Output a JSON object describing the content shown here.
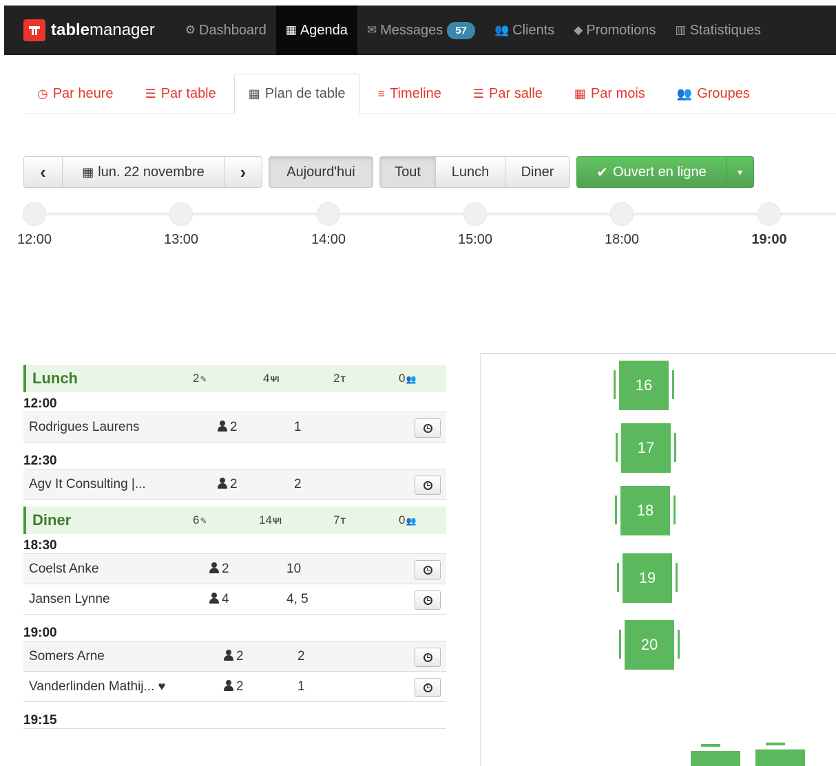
{
  "nav": {
    "brand_bold": "table",
    "brand_rest": "manager",
    "items": [
      {
        "icon": "dashboard-icon",
        "label": "Dashboard"
      },
      {
        "icon": "calendar-icon",
        "label": "Agenda"
      },
      {
        "icon": "envelope-icon",
        "label": "Messages",
        "badge": "57"
      },
      {
        "icon": "users-icon",
        "label": "Clients"
      },
      {
        "icon": "tag-icon",
        "label": "Promotions"
      },
      {
        "icon": "bar-chart-icon",
        "label": "Statistiques"
      }
    ]
  },
  "tabs": [
    {
      "icon": "clock-icon",
      "label": "Par heure"
    },
    {
      "icon": "list-icon",
      "label": "Par table"
    },
    {
      "icon": "grid-icon",
      "label": "Plan de table"
    },
    {
      "icon": "bars-icon",
      "label": "Timeline"
    },
    {
      "icon": "list-icon",
      "label": "Par salle"
    },
    {
      "icon": "calendar-icon",
      "label": "Par mois"
    },
    {
      "icon": "group-icon",
      "label": "Groupes"
    }
  ],
  "controls": {
    "prev": "‹",
    "date": "lun. 22 novembre",
    "next": "›",
    "today": "Aujourd'hui",
    "filters": [
      "Tout",
      "Lunch",
      "Diner"
    ],
    "online": "Ouvert en ligne"
  },
  "timeline": [
    "12:00",
    "13:00",
    "14:00",
    "15:00",
    "18:00",
    "19:00"
  ],
  "services": [
    {
      "name": "Lunch",
      "stats": [
        "2",
        "4",
        "2",
        "0"
      ],
      "slots": [
        {
          "time": "12:00",
          "rows": [
            {
              "name": "Rodrigues Laurens",
              "people": "2",
              "table": "1"
            }
          ]
        },
        {
          "time": "12:30",
          "rows": [
            {
              "name": "Agv It Consulting |...",
              "people": "2",
              "table": "2"
            }
          ]
        }
      ]
    },
    {
      "name": "Diner",
      "stats": [
        "6",
        "14",
        "7",
        "0"
      ],
      "slots": [
        {
          "time": "18:30",
          "rows": [
            {
              "name": "Coelst Anke",
              "people": "2",
              "table": "10"
            },
            {
              "name": "Jansen Lynne",
              "people": "4",
              "table": "4, 5"
            }
          ]
        },
        {
          "time": "19:00",
          "rows": [
            {
              "name": "Somers Arne",
              "people": "2",
              "table": "2"
            },
            {
              "name": "Vanderlinden Mathij...",
              "people": "2",
              "table": "1",
              "heart": true
            }
          ]
        },
        {
          "time": "19:15",
          "rows": []
        }
      ]
    }
  ],
  "floor_tables": [
    "16",
    "17",
    "18",
    "19",
    "20"
  ],
  "colors": {
    "accent": "#e03a2f",
    "green": "#5cb85c",
    "nav": "#222222",
    "badge": "#3a87ad"
  }
}
